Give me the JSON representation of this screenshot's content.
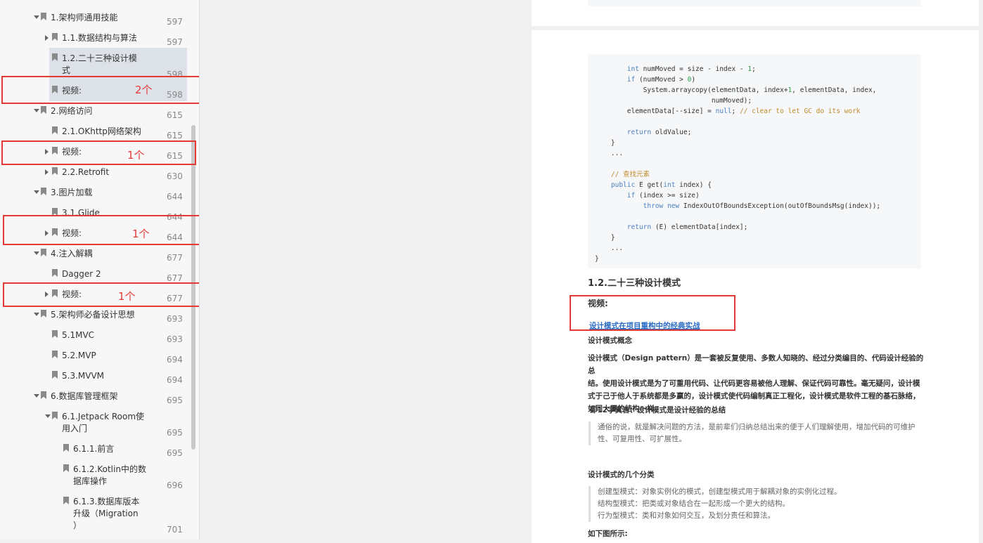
{
  "sidebar": {
    "items": [
      {
        "label": "1.架构师通用技能",
        "page": "597"
      },
      {
        "label": "1.1.数据结构与算法",
        "page": "597"
      },
      {
        "label": "1.2.二十三种设计模",
        "label2": "式",
        "page": "598"
      },
      {
        "label": "视频:",
        "page": "598"
      },
      {
        "label": "2.网络访问",
        "page": "615"
      },
      {
        "label": "2.1.OKhttp网络架构",
        "page": "615"
      },
      {
        "label": "视频:",
        "page": "615"
      },
      {
        "label": "2.2.Retrofit",
        "page": "630"
      },
      {
        "label": "3.图片加载",
        "page": "644"
      },
      {
        "label": "3.1.Glide",
        "page": "644"
      },
      {
        "label": "视频:",
        "page": "644"
      },
      {
        "label": "4.注入解耦",
        "page": "677"
      },
      {
        "label": "Dagger 2",
        "page": "677"
      },
      {
        "label": "视频:",
        "page": "677"
      },
      {
        "label": "5.架构师必备设计思想",
        "page": "693"
      },
      {
        "label": "5.1MVC",
        "page": "693"
      },
      {
        "label": "5.2.MVP",
        "page": "694"
      },
      {
        "label": "5.3.MVVM",
        "page": "694"
      },
      {
        "label": "6.数据库管理框架",
        "page": "695"
      },
      {
        "label": "6.1.Jetpack Room使",
        "label2": "用入门",
        "page": "695"
      },
      {
        "label": "6.1.1.前言",
        "page": "695"
      },
      {
        "label": "6.1.2.Kotlin中的数",
        "label2": "据库操作",
        "page": "696"
      },
      {
        "label": "6.1.3.数据库版本",
        "label2": "升级（Migration",
        "label3": "）",
        "page": "701"
      }
    ],
    "annotations": [
      "2个",
      "1个",
      "1个",
      "1个"
    ]
  },
  "page": {
    "code_lines": [
      "        int numMoved = size - index - 1;",
      "        if (numMoved > 0)",
      "            System.arraycopy(elementData, index+1, elementData, index,",
      "                             numMoved);",
      "        elementData[--size] = null; // clear to let GC do its work",
      "",
      "        return oldValue;",
      "    }",
      "    ...",
      "",
      "    // 查找元素",
      "    public E get(int index) {",
      "        if (index >= size)",
      "            throw new IndexOutOfBoundsException(outOfBoundsMsg(index));",
      "",
      "        return (E) elementData[index];",
      "    }",
      "    ...",
      "}"
    ],
    "heading": "1.2.二十三种设计模式",
    "video_label": "视频:",
    "video_link": "设计模式在项目重构中的经典实战",
    "concept_title": "设计模式概念",
    "concept_body": [
      "设计模式（Design pattern）是一套被反复使用、多数人知晓的、经过分类编目的、代码设计经验的总",
      "结。使用设计模式是为了可重用代码、让代码更容易被他人理解、保证代码可靠性。毫无疑问，设计模",
      "式于己于他人于系统都是多赢的，设计模式使代码编制真正工程化，设计模式是软件工程的基石脉络，",
      "如同大厦的结构一样。"
    ],
    "motto": "即12字真言：设计模式是设计经验的总结",
    "motto_quote": [
      "通俗的说，就是解决问题的方法，是前辈们归纳总结出来的便于人们理解使用，增加代码的可维护",
      "性、可复用性、可扩展性。"
    ],
    "types_title": "设计模式的几个分类",
    "types": [
      "创建型模式：对象实例化的模式，创建型模式用于解耦对象的实例化过程。",
      "结构型模式：把类或对象结合在一起形成一个更大的结构。",
      "行为型模式：类和对象如何交互，及划分责任和算法。"
    ],
    "figure_caption": "如下图所示:"
  }
}
